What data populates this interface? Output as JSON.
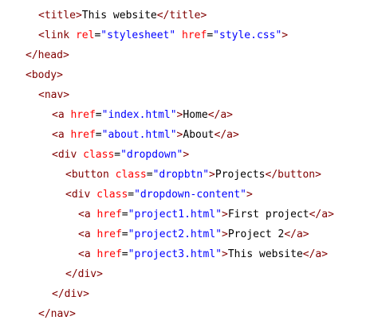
{
  "code": {
    "lines": [
      [
        {
          "t": "<title>"
        },
        {
          "x": "This website"
        },
        {
          "t": "</title>"
        }
      ],
      [
        {
          "t": "<link "
        },
        {
          "a": "rel"
        },
        {
          "x": "="
        },
        {
          "v": "\"stylesheet\""
        },
        {
          "x": " "
        },
        {
          "a": "href"
        },
        {
          "x": "="
        },
        {
          "v": "\"style.css\""
        },
        {
          "t": ">"
        }
      ],
      [
        {
          "t": "</head>"
        }
      ],
      [
        {
          "t": "<body>"
        }
      ],
      [
        {
          "t": "<nav>"
        }
      ],
      [
        {
          "t": "<a "
        },
        {
          "a": "href"
        },
        {
          "x": "="
        },
        {
          "v": "\"index.html\""
        },
        {
          "t": ">"
        },
        {
          "x": "Home"
        },
        {
          "t": "</a>"
        }
      ],
      [
        {
          "t": "<a "
        },
        {
          "a": "href"
        },
        {
          "x": "="
        },
        {
          "v": "\"about.html\""
        },
        {
          "t": ">"
        },
        {
          "x": "About"
        },
        {
          "t": "</a>"
        }
      ],
      [
        {
          "t": "<div "
        },
        {
          "a": "class"
        },
        {
          "x": "="
        },
        {
          "v": "\"dropdown\""
        },
        {
          "t": ">"
        }
      ],
      [
        {
          "t": "<button "
        },
        {
          "a": "class"
        },
        {
          "x": "="
        },
        {
          "v": "\"dropbtn\""
        },
        {
          "t": ">"
        },
        {
          "x": "Projects"
        },
        {
          "t": "</button>"
        }
      ],
      [
        {
          "t": "<div "
        },
        {
          "a": "class"
        },
        {
          "x": "="
        },
        {
          "v": "\"dropdown-content\""
        },
        {
          "t": ">"
        }
      ],
      [
        {
          "t": "<a "
        },
        {
          "a": "href"
        },
        {
          "x": "="
        },
        {
          "v": "\"project1.html\""
        },
        {
          "t": ">"
        },
        {
          "x": "First project"
        },
        {
          "t": "</a>"
        }
      ],
      [
        {
          "t": "<a "
        },
        {
          "a": "href"
        },
        {
          "x": "="
        },
        {
          "v": "\"project2.html\""
        },
        {
          "t": ">"
        },
        {
          "x": "Project 2"
        },
        {
          "t": "</a>"
        }
      ],
      [
        {
          "t": "<a "
        },
        {
          "a": "href"
        },
        {
          "x": "="
        },
        {
          "v": "\"project3.html\""
        },
        {
          "t": ">"
        },
        {
          "x": "This website"
        },
        {
          "t": "</a>"
        }
      ],
      [
        {
          "t": "</div>"
        }
      ],
      [
        {
          "t": "</div>"
        }
      ],
      [
        {
          "t": "</nav>"
        }
      ]
    ]
  },
  "colors": {
    "tag": "#800000",
    "attribute": "#ff0000",
    "value": "#0000ff",
    "text": "#000000",
    "background": "#ffffff"
  }
}
